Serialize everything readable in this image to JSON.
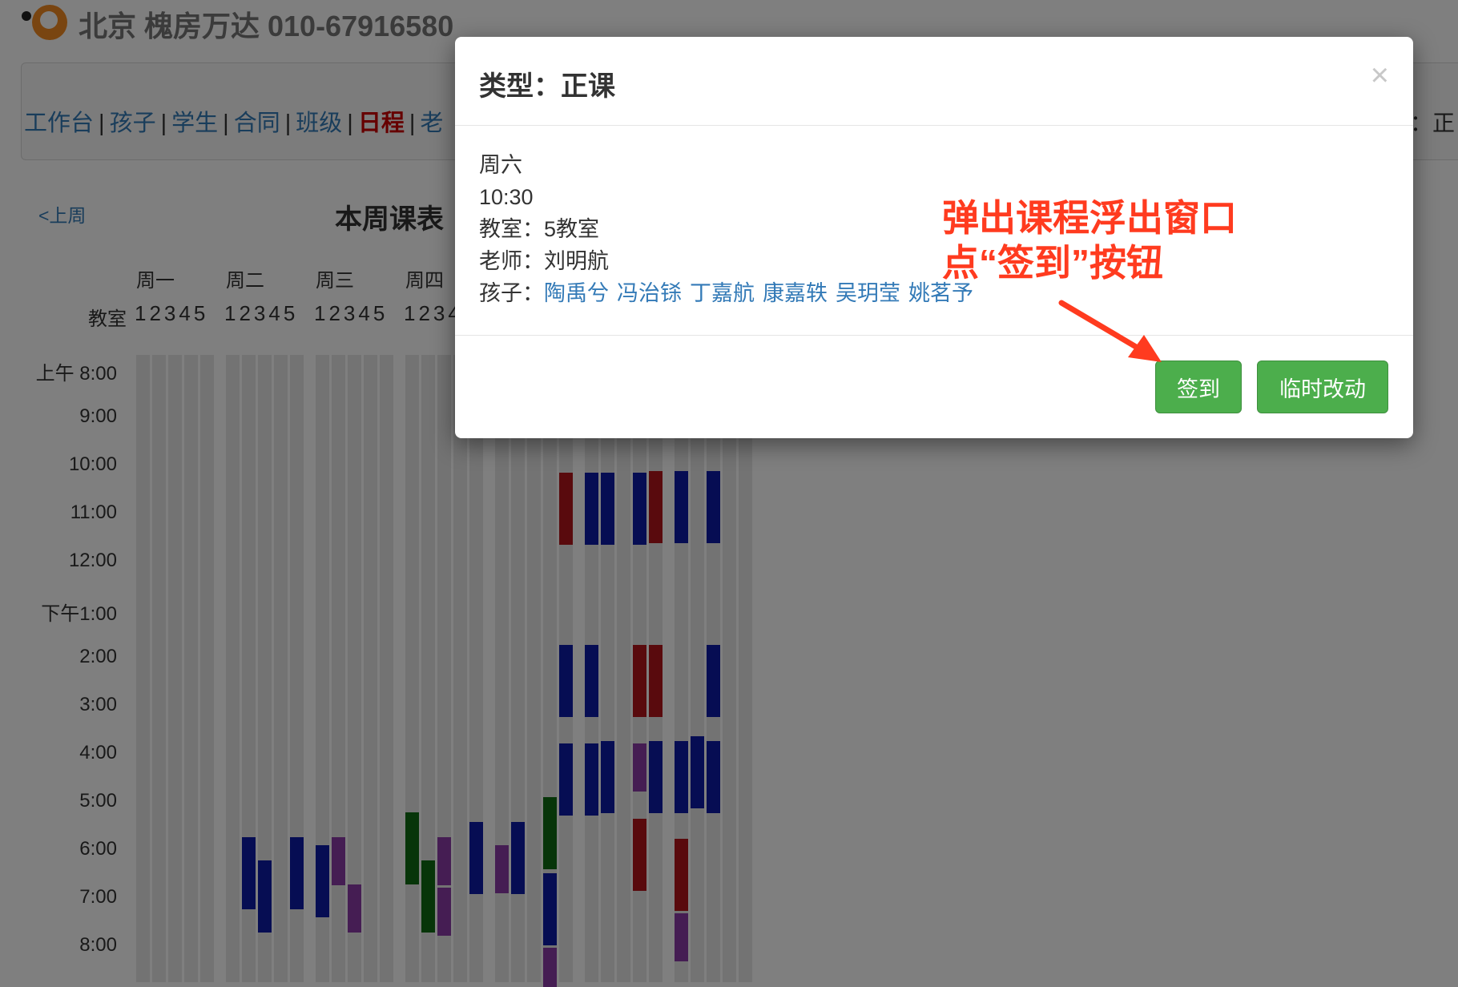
{
  "header": {
    "title": "北京 槐房万达 010-67916580"
  },
  "nav": {
    "items": [
      {
        "label": "工作台"
      },
      {
        "label": "孩子"
      },
      {
        "label": "学生"
      },
      {
        "label": "合同"
      },
      {
        "label": "班级"
      },
      {
        "label": "日程"
      },
      {
        "label": "老"
      }
    ],
    "active": "日程",
    "right_text": "：正"
  },
  "schedule": {
    "prev_week": "<上周",
    "title": "本周课表",
    "days": [
      "周一",
      "周二",
      "周三",
      "周四"
    ],
    "room_label": "教室",
    "room_numbers": "12345",
    "room_numbers_partial": "1234",
    "times": [
      "上午 8:00",
      "9:00",
      "10:00",
      "11:00",
      "12:00",
      "下午1:00",
      "2:00",
      "3:00",
      "4:00",
      "5:00",
      "6:00",
      "7:00",
      "8:00"
    ],
    "colors": {
      "blue": "#0d1aa6",
      "red": "#b3141b",
      "purple": "#8a3aa6",
      "green": "#0f6b12",
      "empty": "#e6e6e6"
    }
  },
  "modal": {
    "title": "类型：正课",
    "close_icon": "×",
    "day": "周六",
    "time": "10:30",
    "room_label": "教室：",
    "room": "5教室",
    "teacher_label": "老师：",
    "teacher": "刘明航",
    "kids_label": "孩子：",
    "kids": [
      "陶禹兮",
      "冯治铩",
      "丁嘉航",
      "康嘉轶",
      "吴玥莹",
      "姚茗予"
    ],
    "buttons": {
      "checkin": "签到",
      "change": "临时改动"
    }
  },
  "annotation": {
    "line1": "弹出课程浮出窗口",
    "line2": "点“签到”按钮",
    "color": "#ff3b1f"
  }
}
